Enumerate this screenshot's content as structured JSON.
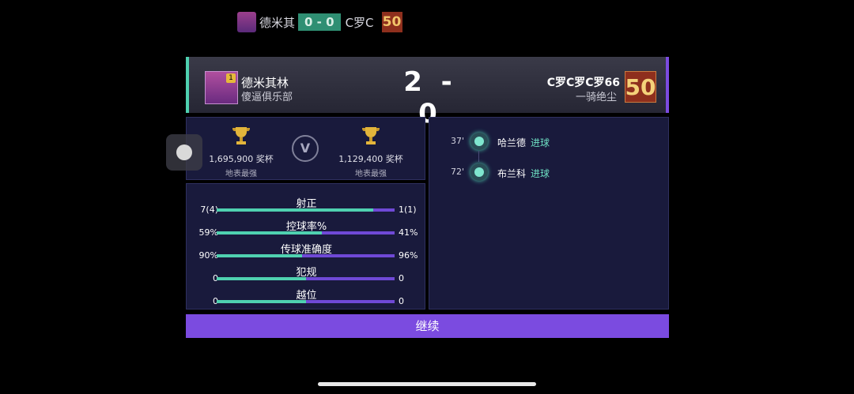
{
  "top_bar": {
    "home": "德米其",
    "score": "0 - 0",
    "away": "C罗C",
    "rating": "50"
  },
  "header": {
    "home_name": "德米其林",
    "home_club": "傻逼俱乐部",
    "home_badge_level": "1",
    "score": "2 - 0",
    "away_name": "C罗C罗C罗66",
    "away_club": "一骑绝尘",
    "away_rating": "50"
  },
  "trophies": {
    "left": {
      "count": "1,695,900 奖杯",
      "sub": "地表最强"
    },
    "right": {
      "count": "1,129,400 奖杯",
      "sub": "地表最强"
    },
    "versus": "V"
  },
  "stats": [
    {
      "title": "射正",
      "left": "7(4)",
      "right": "1(1)",
      "left_share": 0.88
    },
    {
      "title": "控球率%",
      "left": "59%",
      "right": "41%",
      "left_share": 0.59
    },
    {
      "title": "传球准确度",
      "left": "90%",
      "right": "96%",
      "left_share": 0.48
    },
    {
      "title": "犯规",
      "left": "0",
      "right": "0",
      "left_share": 0.5
    },
    {
      "title": "越位",
      "left": "0",
      "right": "0",
      "left_share": 0.5
    }
  ],
  "events": [
    {
      "minute": "37'",
      "player": "哈兰德",
      "type": "进球"
    },
    {
      "minute": "72'",
      "player": "布兰科",
      "type": "进球"
    }
  ],
  "continue_label": "继续",
  "colors": {
    "accent_green": "#4fd1b0",
    "accent_purple": "#7b4be0"
  }
}
